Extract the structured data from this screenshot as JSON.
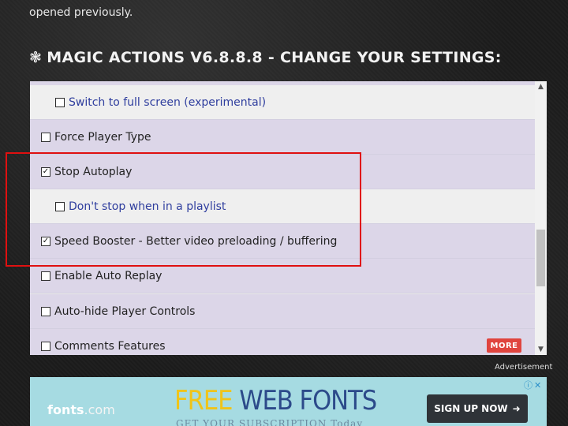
{
  "intro": {
    "text": "opened previously."
  },
  "heading": {
    "icon": "❃",
    "text": "MAGIC ACTIONS V6.8.8.8 - CHANGE YOUR SETTINGS:"
  },
  "settings": {
    "rows": [
      {
        "label": "Switch to full screen (experimental)",
        "checked": false,
        "check_glyph": ""
      },
      {
        "label": "Force Player Type",
        "checked": false,
        "check_glyph": ""
      },
      {
        "label": "Stop Autoplay",
        "checked": true,
        "check_glyph": "✓"
      },
      {
        "label": "Don't stop when in a playlist",
        "checked": false,
        "check_glyph": ""
      },
      {
        "label": "Speed Booster - Better video preloading / buffering",
        "checked": true,
        "check_glyph": "✓"
      },
      {
        "label": "Enable Auto Replay",
        "checked": false,
        "check_glyph": ""
      },
      {
        "label": "Auto-hide Player Controls",
        "checked": false,
        "check_glyph": ""
      },
      {
        "label": "Comments Features",
        "checked": false,
        "check_glyph": ""
      }
    ],
    "more_label": "MORE"
  },
  "scrollbar": {
    "up_glyph": "▲",
    "down_glyph": "▼"
  },
  "advert": {
    "caption": "Advertisement",
    "logo_main": "fonts",
    "logo_suffix": ".com",
    "headline_free": "FREE",
    "headline_rest": " WEB FONTS",
    "subline": "GET YOUR SUBSCRIPTION Today",
    "cta_label": "SIGN UP NOW",
    "cta_arrow": "➜",
    "controls": "ⓘ✕"
  },
  "colors": {
    "main_row_bg": "#dcd6e8",
    "sub_row_bg": "#efefef",
    "sub_label": "#2f3e9e",
    "highlight": "#e01010",
    "more_badge": "#e0443e",
    "ad_bg": "#a6dbe2"
  }
}
